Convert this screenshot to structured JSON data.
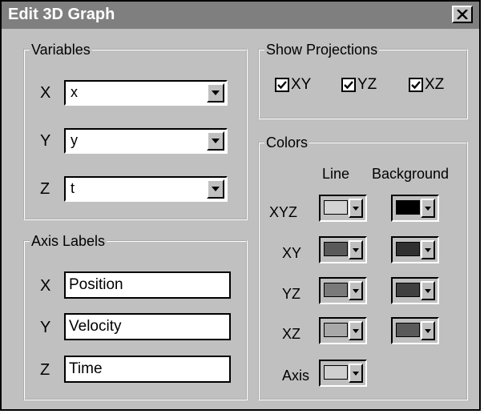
{
  "window": {
    "title": "Edit 3D Graph"
  },
  "variables": {
    "legend": "Variables",
    "rows": [
      {
        "label": "X",
        "value": "x"
      },
      {
        "label": "Y",
        "value": "y"
      },
      {
        "label": "Z",
        "value": "t"
      }
    ]
  },
  "axis_labels": {
    "legend": "Axis Labels",
    "rows": [
      {
        "label": "X",
        "value": "Position"
      },
      {
        "label": "Y",
        "value": "Velocity"
      },
      {
        "label": "Z",
        "value": "Time"
      }
    ]
  },
  "projections": {
    "legend": "Show Projections",
    "items": [
      {
        "label": "XY",
        "checked": true
      },
      {
        "label": "YZ",
        "checked": true
      },
      {
        "label": "XZ",
        "checked": true
      }
    ]
  },
  "colors": {
    "legend": "Colors",
    "col_line": "Line",
    "col_background": "Background",
    "rows": [
      {
        "label": "XYZ",
        "line": "#d4d4d4",
        "background": "#000000"
      },
      {
        "label": "XY",
        "line": "#5a5a5a",
        "background": "#303030"
      },
      {
        "label": "YZ",
        "line": "#7a7a7a",
        "background": "#404040"
      },
      {
        "label": "XZ",
        "line": "#a8a8a8",
        "background": "#5a5a5a"
      },
      {
        "label": "Axis",
        "line": "#cfcfcf"
      }
    ]
  }
}
